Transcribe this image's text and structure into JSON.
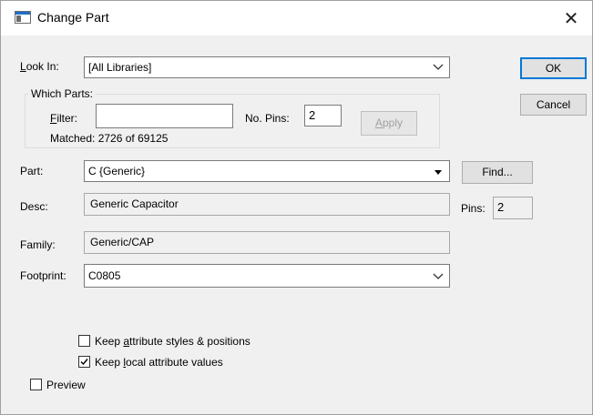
{
  "window": {
    "title": "Change Part",
    "close_glyph": "✕"
  },
  "look_in": {
    "label_prefix": "",
    "label_u": "L",
    "label_rest": "ook In:",
    "value": "[All Libraries]"
  },
  "which_parts": {
    "title": "Which Parts:",
    "filter_label_u": "F",
    "filter_label_rest": "ilter:",
    "filter_value": "",
    "pins_label": "No. Pins:",
    "pins_value": "2",
    "apply_u": "A",
    "apply_rest": "pply",
    "matched": "Matched: 2726 of 69125"
  },
  "part": {
    "label": "Part:",
    "value": "C {Generic}"
  },
  "desc": {
    "label": "Desc:",
    "value": "Generic Capacitor"
  },
  "family": {
    "label": "Family:",
    "value": "Generic/CAP"
  },
  "footprint": {
    "label": "Footprint:",
    "value": "C0805"
  },
  "pins": {
    "label": "Pins:",
    "value": "2"
  },
  "buttons": {
    "ok": "OK",
    "cancel": "Cancel",
    "find": "Find..."
  },
  "options": {
    "keep_styles": {
      "pre": "Keep ",
      "u": "a",
      "post": "ttribute styles & positions",
      "checked": false
    },
    "keep_local": {
      "pre": "Keep ",
      "u": "l",
      "post": "ocal attribute values",
      "checked": true
    },
    "preview": {
      "label": "Preview",
      "checked": false
    }
  },
  "colors": {
    "accent": "#0078d7",
    "dialog_bg": "#f0f0f0"
  },
  "icons": {
    "app": "window-icon",
    "close": "close-icon",
    "dropdown": "chevron-down-icon"
  }
}
